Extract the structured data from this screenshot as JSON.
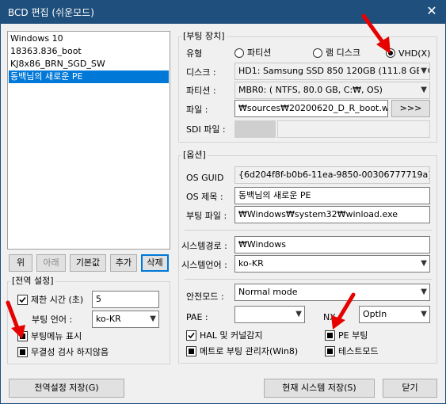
{
  "window": {
    "title": "BCD 편집 (쉬운모드)",
    "close_glyph": "✕"
  },
  "entries": [
    "Windows 10",
    "18363.836_boot",
    "KJ8x86_BRN_SGD_SW",
    "동백님의 새로운 PE"
  ],
  "list_buttons": {
    "up": "위",
    "down": "아래",
    "default": "기본값",
    "add": "추가",
    "delete": "삭제"
  },
  "global": {
    "group_label": "[전역 설정]",
    "timeout_label": "제한 시간 (초)",
    "timeout_value": "5",
    "boot_lang_label": "부팅 언어 :",
    "boot_lang_value": "ko-KR",
    "show_menu_label": "부팅메뉴 표시",
    "no_integrity_label": "무결성 검사 하지않음",
    "save_label": "전역설정 저장(G)"
  },
  "boot_device": {
    "group_label": "[부팅 장치]",
    "type_label": "유형",
    "type_options": [
      "파티션",
      "램 디스크",
      "VHD(X)"
    ],
    "disk_label": "디스크 :",
    "disk_value": "HD1: Samsung SSD 850 120GB (111.8 GB, C: D",
    "partition_label": "파티션 :",
    "partition_value": "MBR0: ( NTFS,  80.0 GB, C:₩, OS)",
    "file_label": "파일 :",
    "file_value": "₩sources₩20200620_D_R_boot.wim",
    "browse_label": ">>>",
    "sdi_label": "SDI 파일 :"
  },
  "options": {
    "group_label": "[옵션]",
    "guid_label": "OS GUID",
    "guid_value": "{6d204f8f-b0b6-11ea-9850-00306777719a}",
    "title_label": "OS 제목 :",
    "title_value": "동백님의 새로운 PE",
    "boot_file_label": "부팅 파일 :",
    "boot_file_value": "₩Windows₩system32₩winload.exe",
    "sysroot_label": "시스템경로 :",
    "sysroot_value": "₩Windows",
    "syslang_label": "시스템언어 :",
    "syslang_value": "ko-KR",
    "safemode_label": "안전모드 :",
    "safemode_value": "Normal mode",
    "pae_label": "PAE :",
    "pae_value": "",
    "nx_label": "NX",
    "nx_value": "OptIn",
    "hal_label": "HAL 및 커널감지",
    "pe_boot_label": "PE 부팅",
    "metro_label": "메트로 부팅 관리자(Win8)",
    "testmode_label": "테스트모드"
  },
  "footer": {
    "save_system_label": "현재 시스템 저장(S)",
    "close_label": "닫기"
  },
  "colors": {
    "titlebar": "#1f4f7c",
    "selection": "#0078d7",
    "annotation_arrow": "#e60000"
  }
}
